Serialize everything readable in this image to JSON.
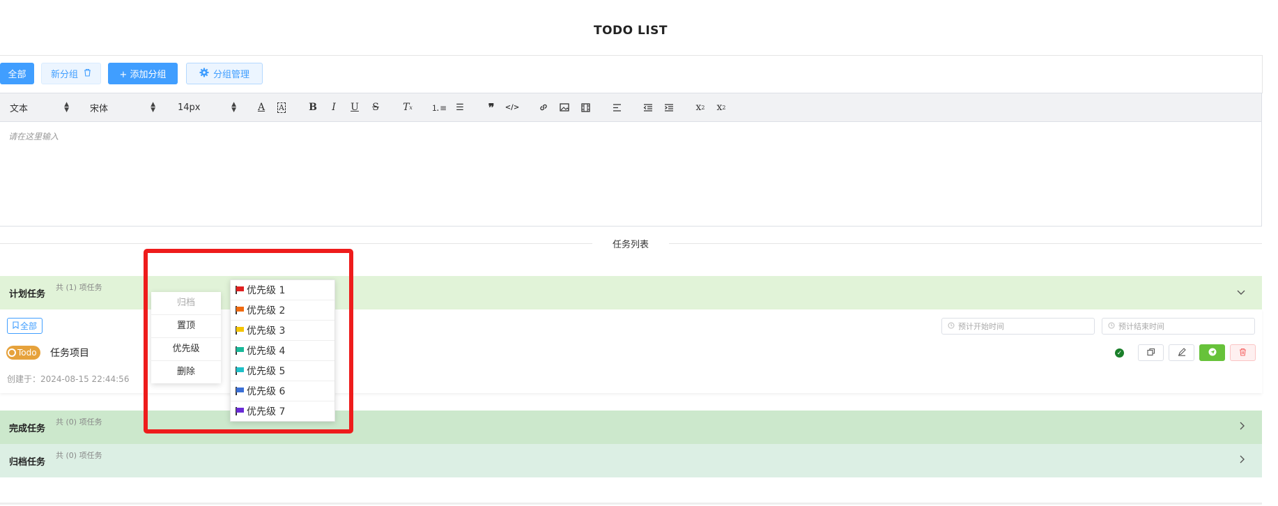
{
  "app": {
    "title": "TODO LIST"
  },
  "groups": {
    "all_label": "全部",
    "new_group_label": "新分组",
    "add_group_label": "+ 添加分组",
    "manage_label": "分组管理"
  },
  "toolbar": {
    "block_type": "文本",
    "font_family": "宋体",
    "font_size": "14px",
    "icons": [
      "font-color-icon",
      "background-color-icon",
      "bold-icon",
      "italic-icon",
      "underline-icon",
      "strikethrough-icon",
      "clear-format-icon",
      "ordered-list-icon",
      "bullet-list-icon",
      "blockquote-icon",
      "code-icon",
      "link-icon",
      "image-icon",
      "video-icon",
      "align-left-icon",
      "outdent-icon",
      "indent-icon",
      "subscript-icon",
      "superscript-icon"
    ]
  },
  "editor": {
    "placeholder": "请在这里输入"
  },
  "task_list": {
    "divider_label": "任务列表"
  },
  "sections": {
    "plan": {
      "title": "计划任务",
      "count_text": "共 (1) 项任务"
    },
    "done": {
      "title": "完成任务",
      "count_text": "共 (0) 项任务"
    },
    "archive": {
      "title": "归档任务",
      "count_text": "共 (0) 项任务"
    }
  },
  "plan_body": {
    "filter_tag": "全部",
    "start_placeholder": "预计开始时间",
    "end_placeholder": "预计结束时间",
    "badge": "Todo",
    "task_name": "任务项目",
    "created": "创建于：2024-08-15 22:44:56"
  },
  "context_menu": {
    "items": [
      "归档",
      "置顶",
      "优先级",
      "删除"
    ]
  },
  "priority_menu": {
    "items": [
      {
        "label": "优先级 1",
        "color": "#e02020"
      },
      {
        "label": "优先级 2",
        "color": "#f06a10"
      },
      {
        "label": "优先级 3",
        "color": "#f5c400"
      },
      {
        "label": "优先级 4",
        "color": "#19b99a"
      },
      {
        "label": "优先级 5",
        "color": "#1fc0c8"
      },
      {
        "label": "优先级 6",
        "color": "#3b6fd6"
      },
      {
        "label": "优先级 7",
        "color": "#6a2bd6"
      }
    ]
  },
  "colors": {
    "primary": "#409eff",
    "highlight": "#ee1c1c",
    "badge": "#e6a23c"
  }
}
